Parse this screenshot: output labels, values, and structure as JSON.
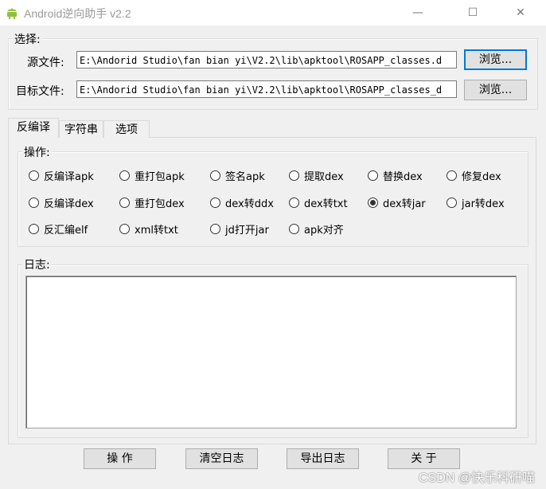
{
  "window": {
    "title": "Android逆向助手 v2.2",
    "minimize": "—",
    "maximize": "☐",
    "close": "✕"
  },
  "select_group": {
    "label": "选择:",
    "source_label": "源文件:",
    "source_value": "E:\\Andorid Studio\\fan bian yi\\V2.2\\lib\\apktool\\ROSAPP_classes.d",
    "target_label": "目标文件:",
    "target_value": "E:\\Andorid Studio\\fan bian yi\\V2.2\\lib\\apktool\\ROSAPP_classes_d",
    "browse1": "浏览...",
    "browse2": "浏览..."
  },
  "tabs": [
    "反编译",
    "字符串",
    "选项"
  ],
  "operation_group": {
    "label": "操作:",
    "options": [
      {
        "label": "反编译apk",
        "checked": false
      },
      {
        "label": "重打包apk",
        "checked": false
      },
      {
        "label": "签名apk",
        "checked": false
      },
      {
        "label": "提取dex",
        "checked": false
      },
      {
        "label": "替换dex",
        "checked": false
      },
      {
        "label": "修复dex",
        "checked": false
      },
      {
        "label": "反编译dex",
        "checked": false
      },
      {
        "label": "重打包dex",
        "checked": false
      },
      {
        "label": "dex转ddx",
        "checked": false
      },
      {
        "label": "dex转txt",
        "checked": false
      },
      {
        "label": "dex转jar",
        "checked": true
      },
      {
        "label": "jar转dex",
        "checked": false
      },
      {
        "label": "反汇编elf",
        "checked": false
      },
      {
        "label": "xml转txt",
        "checked": false
      },
      {
        "label": "jd打开jar",
        "checked": false
      },
      {
        "label": "apk对齐",
        "checked": false
      }
    ]
  },
  "log_group": {
    "label": "日志:"
  },
  "buttons": {
    "operate": "操  作",
    "clear_log": "清空日志",
    "export_log": "导出日志",
    "about": "关  于"
  },
  "watermark": "CSDN @快乐科研喵",
  "colors": {
    "focus": "#0078d7",
    "android_green": "#8fbf3f"
  }
}
